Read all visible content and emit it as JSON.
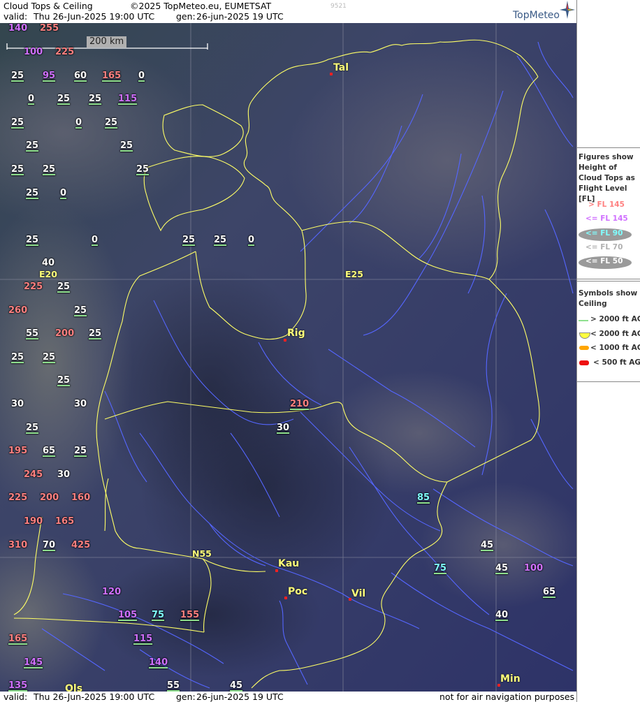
{
  "header": {
    "product": "Cloud Tops & Ceiling",
    "copyright": "©2025 TopMeteo.eu, EUMETSAT",
    "image_no": "9521",
    "valid_prefix": "valid:",
    "valid_time": "Thu  26-Jun-2025  19:00 UTC",
    "gen_prefix": "gen:",
    "gen_time": "26-jun-2025 19 UTC",
    "logo_text": "TopMeteo"
  },
  "footer": {
    "valid_prefix": "valid:",
    "valid_time": "Thu  26-Jun-2025  19:00 UTC",
    "gen_prefix": "gen:",
    "gen_time": "26-jun-2025 19 UTC",
    "disclaimer": "not for air navigation purposes"
  },
  "scale": {
    "label": "200 km"
  },
  "grid_labels": {
    "e20": "E20",
    "e25": "E25",
    "n55": "N55"
  },
  "cities": [
    {
      "name": "Tal"
    },
    {
      "name": "Rig"
    },
    {
      "name": "Kau"
    },
    {
      "name": "Poc"
    },
    {
      "name": "Vil"
    },
    {
      "name": "Min"
    },
    {
      "name": "Ols"
    }
  ],
  "legend_tops": {
    "title": "Figures show Height of Cloud Tops as Flight Level  [FL]",
    "items": [
      {
        "label": "> FL 145",
        "color": "#ff8080"
      },
      {
        "label": "<= FL 145",
        "color": "#d070ff"
      },
      {
        "label": "<= FL 90",
        "color": "#80ffff"
      },
      {
        "label": "<= FL 70",
        "color": "#c8c8c8"
      },
      {
        "label": "<= FL 50",
        "color": "#ffffff"
      }
    ]
  },
  "legend_ceiling": {
    "title": "Symbols show Ceiling",
    "items": [
      {
        "label": "> 2000 ft AGL",
        "color": "#8fe08f"
      },
      {
        "label": "< 2000 ft AGL",
        "color": "#ffff40"
      },
      {
        "label": "< 1000 ft AGL",
        "color": "#ffa500"
      },
      {
        "label": "< 500 ft AGL",
        "color": "#ee1010"
      }
    ]
  },
  "cloud_labels": [
    {
      "v": "140",
      "c": "p"
    },
    {
      "v": "255",
      "c": "r"
    },
    {
      "v": "100",
      "c": "p"
    },
    {
      "v": "225",
      "c": "r"
    },
    {
      "v": "25",
      "c": "w"
    },
    {
      "v": "95",
      "c": "p"
    },
    {
      "v": "60",
      "c": "w"
    },
    {
      "v": "165",
      "c": "r"
    },
    {
      "v": "0",
      "c": "w"
    },
    {
      "v": "0",
      "c": "w"
    },
    {
      "v": "25",
      "c": "w"
    },
    {
      "v": "25",
      "c": "w"
    },
    {
      "v": "115",
      "c": "p"
    },
    {
      "v": "25",
      "c": "w"
    },
    {
      "v": "0",
      "c": "w"
    },
    {
      "v": "25",
      "c": "w"
    },
    {
      "v": "25",
      "c": "w"
    },
    {
      "v": "25",
      "c": "w"
    },
    {
      "v": "25",
      "c": "w"
    },
    {
      "v": "25",
      "c": "w"
    },
    {
      "v": "25",
      "c": "w"
    },
    {
      "v": "25",
      "c": "w"
    },
    {
      "v": "0",
      "c": "w"
    },
    {
      "v": "25",
      "c": "w"
    },
    {
      "v": "0",
      "c": "w"
    },
    {
      "v": "25",
      "c": "w"
    },
    {
      "v": "25",
      "c": "w"
    },
    {
      "v": "0",
      "c": "w"
    },
    {
      "v": "40",
      "c": "w"
    },
    {
      "v": "225",
      "c": "r"
    },
    {
      "v": "25",
      "c": "w"
    },
    {
      "v": "260",
      "c": "r"
    },
    {
      "v": "25",
      "c": "w"
    },
    {
      "v": "55",
      "c": "w"
    },
    {
      "v": "200",
      "c": "r"
    },
    {
      "v": "25",
      "c": "w"
    },
    {
      "v": "25",
      "c": "w"
    },
    {
      "v": "25",
      "c": "w"
    },
    {
      "v": "25",
      "c": "w"
    },
    {
      "v": "30",
      "c": "w"
    },
    {
      "v": "30",
      "c": "w"
    },
    {
      "v": "210",
      "c": "r"
    },
    {
      "v": "25",
      "c": "w"
    },
    {
      "v": "30",
      "c": "w"
    },
    {
      "v": "195",
      "c": "r"
    },
    {
      "v": "65",
      "c": "w"
    },
    {
      "v": "25",
      "c": "w"
    },
    {
      "v": "245",
      "c": "r"
    },
    {
      "v": "30",
      "c": "w"
    },
    {
      "v": "225",
      "c": "r"
    },
    {
      "v": "200",
      "c": "r"
    },
    {
      "v": "160",
      "c": "r"
    },
    {
      "v": "85",
      "c": "c"
    },
    {
      "v": "190",
      "c": "r"
    },
    {
      "v": "165",
      "c": "r"
    },
    {
      "v": "310",
      "c": "r"
    },
    {
      "v": "70",
      "c": "w"
    },
    {
      "v": "425",
      "c": "r"
    },
    {
      "v": "45",
      "c": "w"
    },
    {
      "v": "75",
      "c": "c"
    },
    {
      "v": "45",
      "c": "w"
    },
    {
      "v": "100",
      "c": "p"
    },
    {
      "v": "120",
      "c": "p"
    },
    {
      "v": "65",
      "c": "w"
    },
    {
      "v": "105",
      "c": "p"
    },
    {
      "v": "75",
      "c": "c"
    },
    {
      "v": "155",
      "c": "r"
    },
    {
      "v": "40",
      "c": "w"
    },
    {
      "v": "165",
      "c": "r"
    },
    {
      "v": "115",
      "c": "p"
    },
    {
      "v": "145",
      "c": "p"
    },
    {
      "v": "140",
      "c": "p"
    },
    {
      "v": "135",
      "c": "p"
    },
    {
      "v": "55",
      "c": "w"
    },
    {
      "v": "45",
      "c": "w"
    }
  ],
  "colors": {
    "r": "#ff8080",
    "p": "#d070ff",
    "c": "#80ffff",
    "w": "#ffffff",
    "border": "#ffff66",
    "river": "#5566ff",
    "grid": "#9a9aaa"
  }
}
